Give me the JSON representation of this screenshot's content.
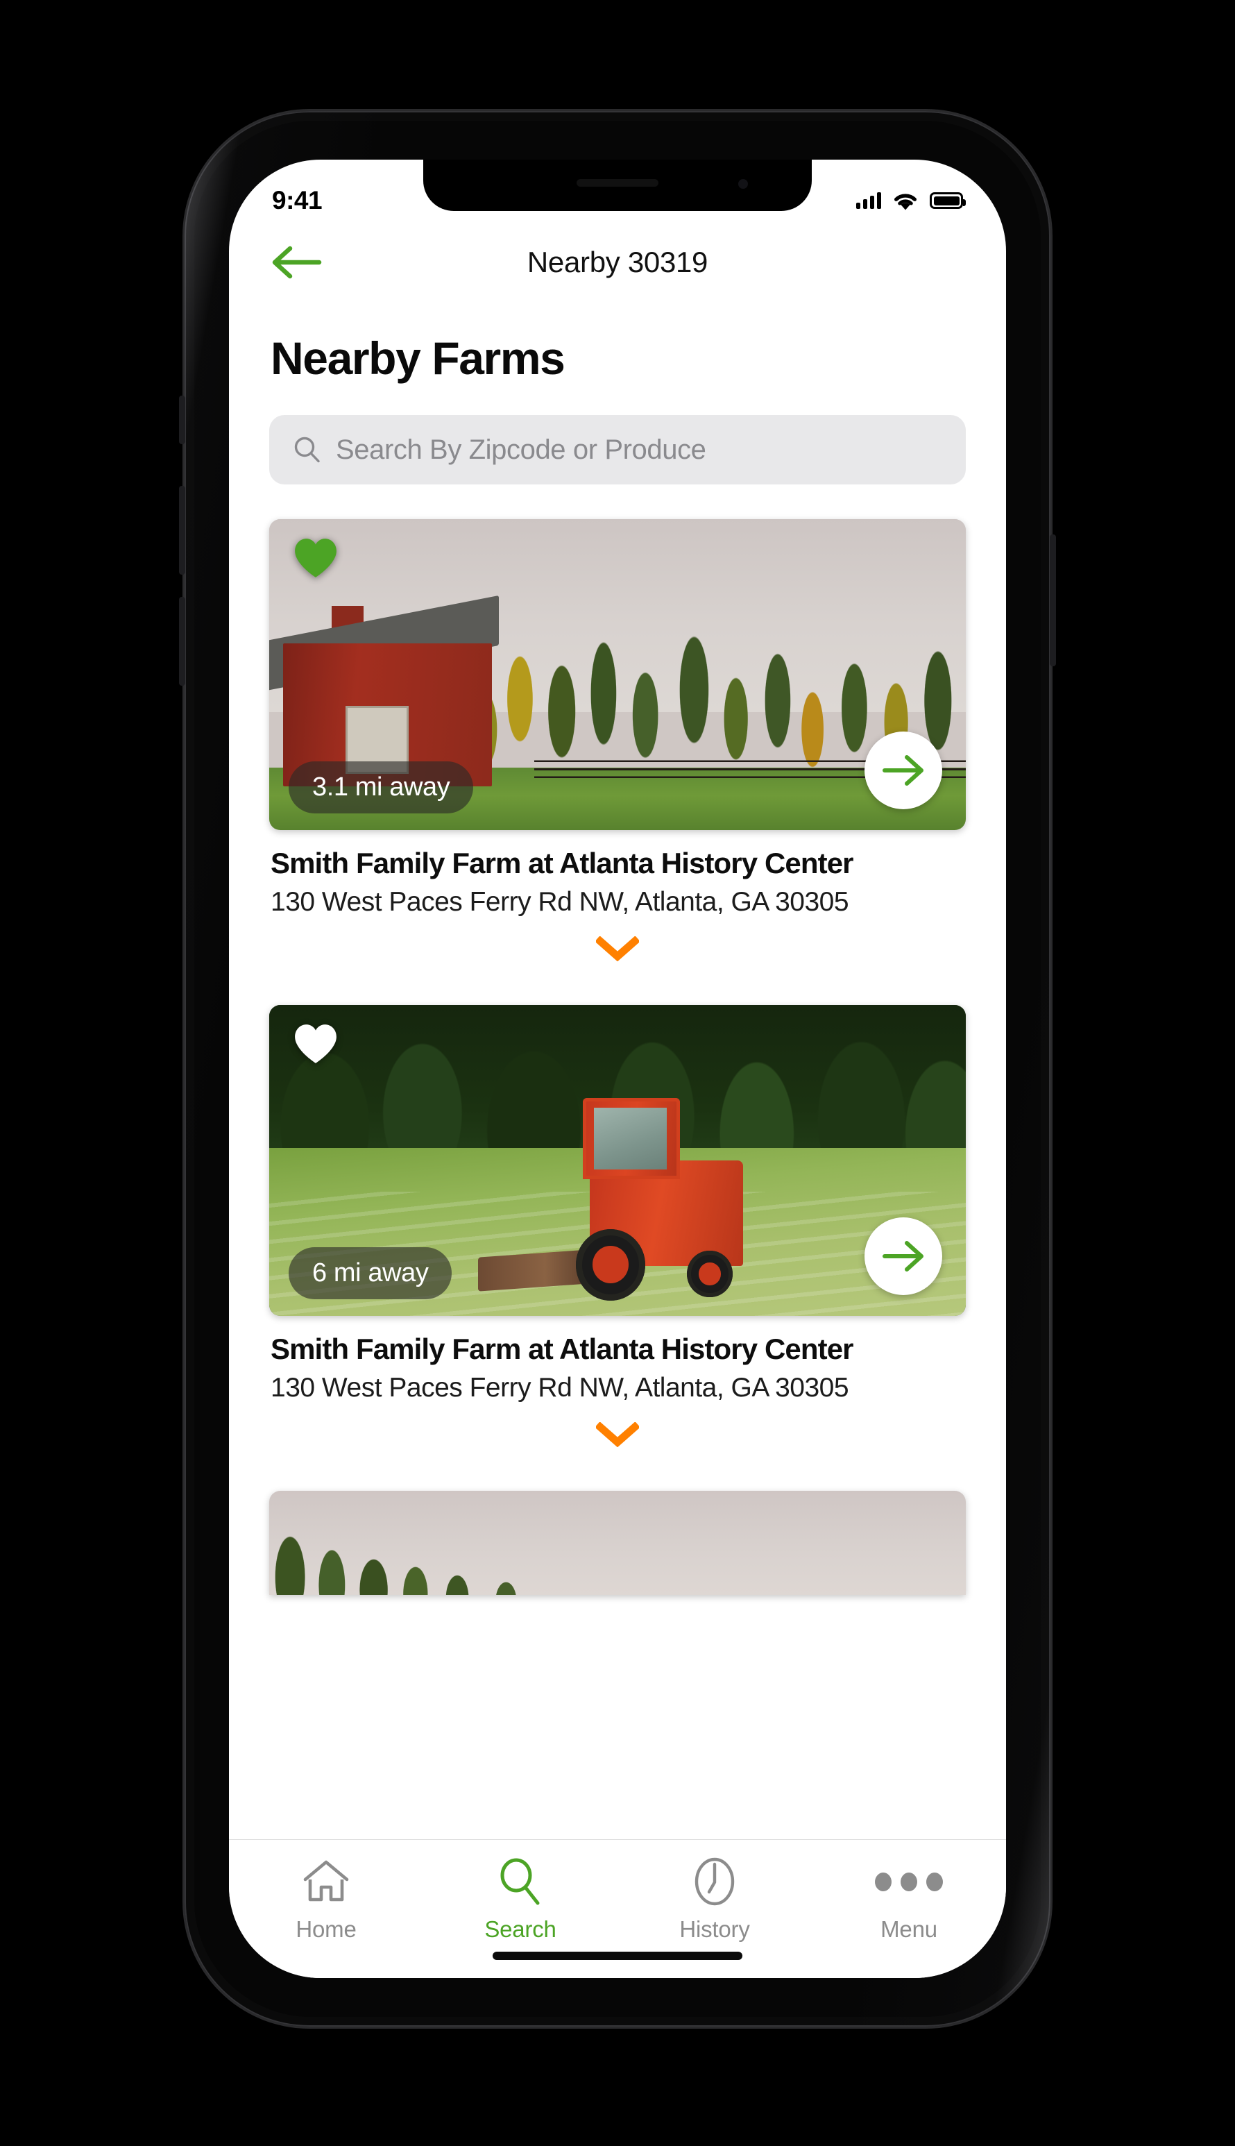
{
  "status_bar": {
    "time": "9:41",
    "cellular_icon": "signal-bars-icon",
    "wifi_icon": "wifi-icon",
    "battery_icon": "battery-full-icon"
  },
  "nav": {
    "back_icon": "arrow-left-icon",
    "title": "Nearby 30319"
  },
  "page": {
    "title": "Nearby Farms"
  },
  "search": {
    "icon": "search-icon",
    "placeholder": "Search By Zipcode or Produce",
    "value": ""
  },
  "colors": {
    "accent_green": "#4CA425",
    "expand_orange": "#FF8000",
    "search_field_bg": "#E8E8EA",
    "badge_bg": "rgba(42,42,38,0.62)",
    "tab_inactive": "#8C8C8C"
  },
  "farms": [
    {
      "image": "red-barn-autumn-forest-photo",
      "favorite": true,
      "favorite_icon": "heart-filled-icon",
      "distance": "3.1 mi away",
      "go_icon": "arrow-right-icon",
      "name": "Smith Family Farm at Atlanta History Center",
      "address": "130 West Paces Ferry Rd NW, Atlanta, GA 30305",
      "expand_icon": "chevron-down-icon"
    },
    {
      "image": "red-tractor-hayfield-photo",
      "favorite": false,
      "favorite_icon": "heart-outline-icon",
      "distance": "6 mi away",
      "go_icon": "arrow-right-icon",
      "name": "Smith Family Farm at Atlanta History Center",
      "address": "130 West Paces Ferry Rd NW, Atlanta, GA 30305",
      "expand_icon": "chevron-down-icon"
    },
    {
      "image": "overcast-sky-treeline-photo",
      "favorite": false,
      "favorite_icon": "heart-outline-icon",
      "distance": "",
      "go_icon": "arrow-right-icon",
      "name": "",
      "address": "",
      "expand_icon": "chevron-down-icon"
    }
  ],
  "tabs": [
    {
      "label": "Home",
      "icon": "home-icon",
      "active": false
    },
    {
      "label": "Search",
      "icon": "search-icon",
      "active": true
    },
    {
      "label": "History",
      "icon": "clock-icon",
      "active": false
    },
    {
      "label": "Menu",
      "icon": "dots-icon",
      "active": false
    }
  ]
}
